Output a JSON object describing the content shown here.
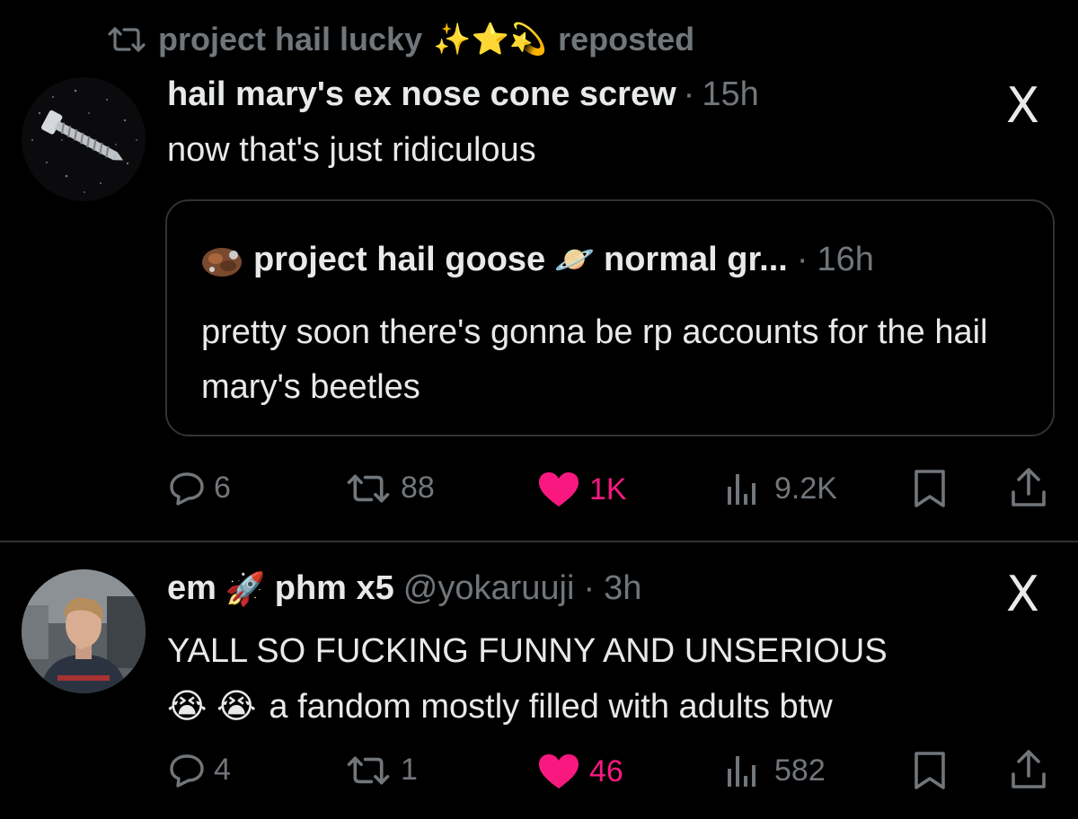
{
  "tweet1": {
    "repost_by": "project hail lucky",
    "repost_emojis": "✨⭐💫",
    "repost_suffix": "reposted",
    "author_name": "hail mary's ex nose cone screw",
    "separator": "·",
    "time": "15h",
    "x_logo": "X",
    "text": "now that's just ridiculous",
    "quote": {
      "author_name": "project hail goose",
      "author_badge_emoji": "🪐",
      "author_display": "normal gr...",
      "separator": "·",
      "time": "16h",
      "text": "pretty soon there's gonna be rp accounts for the hail mary's beetles"
    },
    "actions": {
      "replies": "6",
      "reposts": "88",
      "likes": "1K",
      "views": "9.2K"
    }
  },
  "tweet2": {
    "author_name": "em",
    "author_emoji": "🚀",
    "author_name2": "phm x5",
    "handle": "@yokaruuji",
    "separator": "·",
    "time": "3h",
    "x_logo": "X",
    "text_line1": "YALL SO FUCKING FUNNY AND UNSERIOUS",
    "text_emojis": "😭 😭",
    "text_line2": "a fandom mostly filled with adults btw",
    "actions": {
      "replies": "4",
      "reposts": "1",
      "likes": "46",
      "views": "582"
    }
  },
  "colors": {
    "background": "#000000",
    "text": "#e7e9ea",
    "muted": "#71767b",
    "like": "#f91880",
    "border": "#2f3336"
  }
}
